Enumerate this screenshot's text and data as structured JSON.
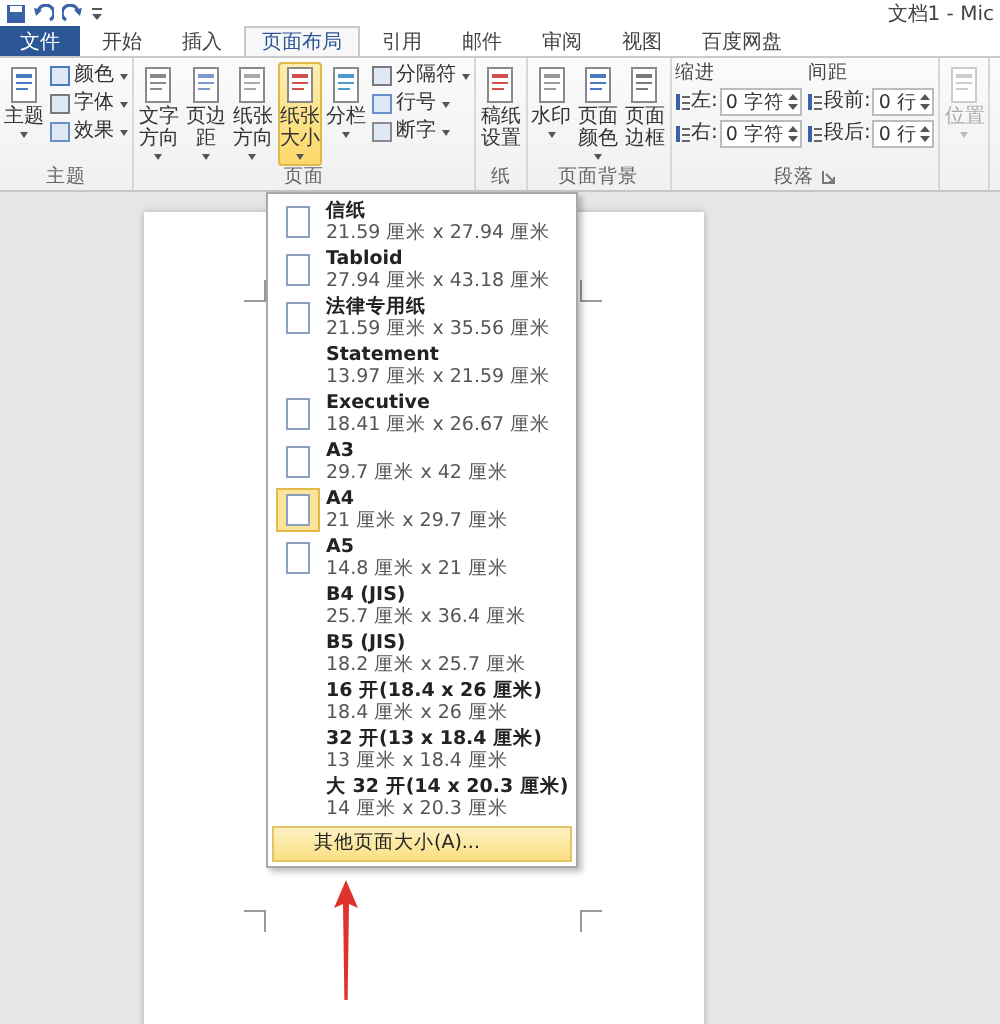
{
  "title_bar": {
    "title": "文档1 - Mic"
  },
  "tabs": [
    {
      "label": "文件",
      "kind": "file",
      "selected": false
    },
    {
      "label": "开始",
      "kind": "tab",
      "selected": false
    },
    {
      "label": "插入",
      "kind": "tab",
      "selected": false
    },
    {
      "label": "页面布局",
      "kind": "tab",
      "selected": true
    },
    {
      "label": "引用",
      "kind": "tab",
      "selected": false
    },
    {
      "label": "邮件",
      "kind": "tab",
      "selected": false
    },
    {
      "label": "审阅",
      "kind": "tab",
      "selected": false
    },
    {
      "label": "视图",
      "kind": "tab",
      "selected": false
    },
    {
      "label": "百度网盘",
      "kind": "tab",
      "selected": false
    }
  ],
  "ribbon_groups": [
    {
      "label": "主题",
      "launcher": false,
      "items": [
        {
          "kind": "big",
          "label": "主题",
          "caret": true,
          "selected": false,
          "disabled": false
        },
        {
          "kind": "stack",
          "items": [
            {
              "label": "颜色",
              "caret": true
            },
            {
              "label": "字体",
              "caret": true
            },
            {
              "label": "效果",
              "caret": true
            }
          ]
        }
      ]
    },
    {
      "label": "页面",
      "launcher": false,
      "items": [
        {
          "kind": "big",
          "label": "文字方向",
          "caret": true,
          "selected": false,
          "disabled": false
        },
        {
          "kind": "big",
          "label": "页边距",
          "caret": true,
          "selected": false,
          "disabled": false
        },
        {
          "kind": "big",
          "label": "纸张方向",
          "caret": true,
          "selected": false,
          "disabled": false
        },
        {
          "kind": "big",
          "label": "纸张大小",
          "caret": true,
          "selected": true,
          "disabled": false
        },
        {
          "kind": "big",
          "label": "分栏",
          "caret": true,
          "selected": false,
          "disabled": false
        },
        {
          "kind": "stack",
          "items": [
            {
              "label": "分隔符",
              "caret": true
            },
            {
              "label": "行号",
              "caret": true
            },
            {
              "label": "断字",
              "caret": true
            }
          ]
        }
      ]
    },
    {
      "label": "纸",
      "launcher": false,
      "items": [
        {
          "kind": "big",
          "label": "稿纸设置",
          "caret": false,
          "selected": false,
          "disabled": false
        }
      ]
    },
    {
      "label": "页面背景",
      "launcher": false,
      "items": [
        {
          "kind": "big",
          "label": "水印",
          "caret": true,
          "selected": false,
          "disabled": false
        },
        {
          "kind": "big",
          "label": "页面颜色",
          "caret": true,
          "selected": false,
          "disabled": false
        },
        {
          "kind": "big",
          "label": "页面边框",
          "caret": false,
          "selected": false,
          "disabled": false
        }
      ]
    },
    {
      "label": "段落",
      "launcher": true,
      "items": [
        {
          "kind": "spin",
          "heading": "缩进",
          "rows": [
            {
              "label": "左:",
              "value": "0 字符"
            },
            {
              "label": "右:",
              "value": "0 字符"
            }
          ]
        },
        {
          "kind": "spin",
          "heading": "间距",
          "rows": [
            {
              "label": "段前:",
              "value": "0 行"
            },
            {
              "label": "段后:",
              "value": "0 行"
            }
          ]
        }
      ]
    },
    {
      "launcher": false,
      "items": [
        {
          "kind": "big",
          "label": "位置",
          "caret": true,
          "selected": false,
          "disabled": true
        }
      ]
    }
  ],
  "paper_menu": {
    "items": [
      {
        "name": "信纸",
        "size": "21.59 厘米 x 27.94 厘米",
        "icon": true,
        "selected": false
      },
      {
        "name": "Tabloid",
        "size": "27.94 厘米 x 43.18 厘米",
        "icon": true,
        "selected": false
      },
      {
        "name": "法律专用纸",
        "size": "21.59 厘米 x 35.56 厘米",
        "icon": true,
        "selected": false
      },
      {
        "name": "Statement",
        "size": "13.97 厘米 x 21.59 厘米",
        "icon": false,
        "selected": false
      },
      {
        "name": "Executive",
        "size": "18.41 厘米 x 26.67 厘米",
        "icon": true,
        "selected": false
      },
      {
        "name": "A3",
        "size": "29.7 厘米 x 42 厘米",
        "icon": true,
        "selected": false
      },
      {
        "name": "A4",
        "size": "21 厘米 x 29.7 厘米",
        "icon": true,
        "selected": true
      },
      {
        "name": "A5",
        "size": "14.8 厘米 x 21 厘米",
        "icon": true,
        "selected": false
      },
      {
        "name": "B4 (JIS)",
        "size": "25.7 厘米 x 36.4 厘米",
        "icon": false,
        "selected": false
      },
      {
        "name": "B5 (JIS)",
        "size": "18.2 厘米 x 25.7 厘米",
        "icon": false,
        "selected": false
      },
      {
        "name": "16 开(18.4 x 26 厘米)",
        "size": "18.4 厘米 x 26 厘米",
        "icon": false,
        "selected": false
      },
      {
        "name": "32 开(13 x 18.4 厘米)",
        "size": "13 厘米 x 18.4 厘米",
        "icon": false,
        "selected": false
      },
      {
        "name": "大 32 开(14 x 20.3 厘米)",
        "size": "14 厘米 x 20.3 厘米",
        "icon": false,
        "selected": false
      }
    ],
    "footer": {
      "label": "其他页面大小(A)...",
      "selected": true
    }
  }
}
